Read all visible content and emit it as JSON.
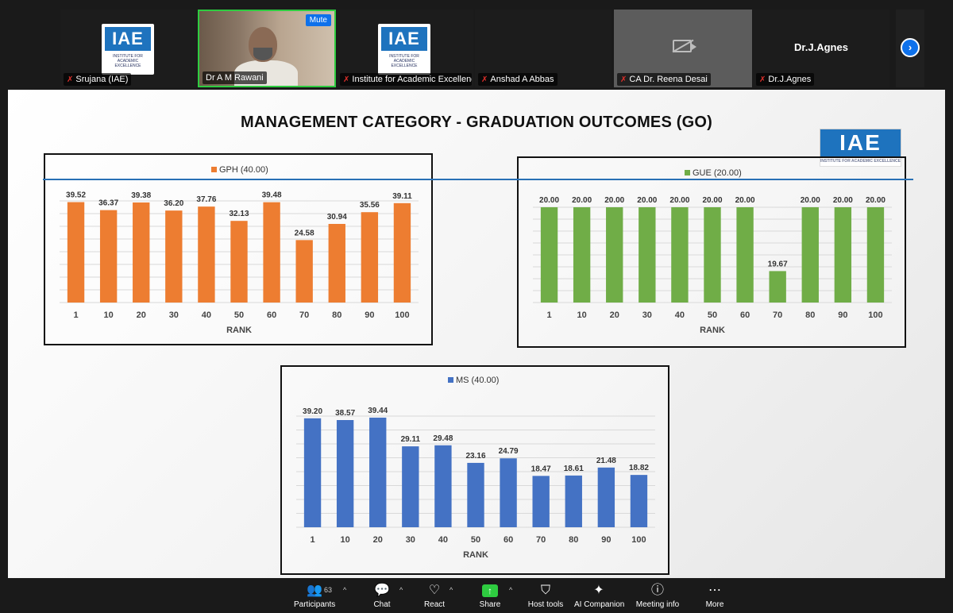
{
  "participants": [
    {
      "name": "Srujana (IAE)",
      "type": "logo"
    },
    {
      "name": "Dr A M Rawani",
      "type": "video"
    },
    {
      "name": "Institute for Academic Excellence...",
      "type": "logo"
    },
    {
      "name": "Anshad A Abbas",
      "type": "dark"
    },
    {
      "name": "CA Dr. Reena Desai",
      "type": "camera-off"
    },
    {
      "name": "Dr.J.Agnes",
      "type": "text",
      "display": "Dr.J.Agnes"
    }
  ],
  "mute_label": "Mute",
  "logo": {
    "text": "IAE",
    "subtitle": "INSTITUTE FOR ACADEMIC EXCELLENCE"
  },
  "slide": {
    "title": "MANAGEMENT CATEGORY - GRADUATION OUTCOMES (GO)"
  },
  "colors": {
    "gph": "#ed7d31",
    "gue": "#70ad47",
    "ms": "#4472c4",
    "accent": "#0e71eb",
    "muted_mic": "#e0302b",
    "active_speaker": "#2ecc40"
  },
  "chart_data": [
    {
      "type": "bar",
      "legend": "GPH (40.00)",
      "xlabel": "RANK",
      "categories": [
        "1",
        "10",
        "20",
        "30",
        "40",
        "50",
        "60",
        "70",
        "80",
        "90",
        "100"
      ],
      "values": [
        39.52,
        36.37,
        39.38,
        36.2,
        37.76,
        32.13,
        39.48,
        24.58,
        30.94,
        35.56,
        39.11
      ],
      "labels": [
        "39.52",
        "36.37",
        "39.38",
        "36.20",
        "37.76",
        "32.13",
        "39.48",
        "24.58",
        "30.94",
        "35.56",
        "39.11"
      ],
      "ylim": [
        0,
        40
      ],
      "grid": true,
      "legend_position": "top-center"
    },
    {
      "type": "bar",
      "legend": "GUE (20.00)",
      "xlabel": "RANK",
      "categories": [
        "1",
        "10",
        "20",
        "30",
        "40",
        "50",
        "60",
        "70",
        "80",
        "90",
        "100"
      ],
      "values": [
        20.0,
        20.0,
        20.0,
        20.0,
        20.0,
        20.0,
        20.0,
        19.67,
        20.0,
        20.0,
        20.0
      ],
      "labels": [
        "20.00",
        "20.00",
        "20.00",
        "20.00",
        "20.00",
        "20.00",
        "20.00",
        "19.67",
        "20.00",
        "20.00",
        "20.00"
      ],
      "ylim": [
        19.6,
        20
      ],
      "grid": true,
      "legend_position": "top-center"
    },
    {
      "type": "bar",
      "legend": "MS (40.00)",
      "xlabel": "RANK",
      "categories": [
        "1",
        "10",
        "20",
        "30",
        "40",
        "50",
        "60",
        "70",
        "80",
        "90",
        "100"
      ],
      "values": [
        39.2,
        38.57,
        39.44,
        29.11,
        29.48,
        23.16,
        24.79,
        18.47,
        18.61,
        21.48,
        18.82
      ],
      "labels": [
        "39.20",
        "38.57",
        "39.44",
        "29.11",
        "29.48",
        "23.16",
        "24.79",
        "18.47",
        "18.61",
        "21.48",
        "18.82"
      ],
      "ylim": [
        0,
        40
      ],
      "grid": true,
      "legend_position": "top-center"
    }
  ],
  "toolbar": {
    "participants_label": "Participants",
    "participants_count": "63",
    "chat_label": "Chat",
    "react_label": "React",
    "share_label": "Share",
    "host_tools_label": "Host tools",
    "ai_companion_label": "AI Companion",
    "meeting_info_label": "Meeting info",
    "more_label": "More"
  }
}
